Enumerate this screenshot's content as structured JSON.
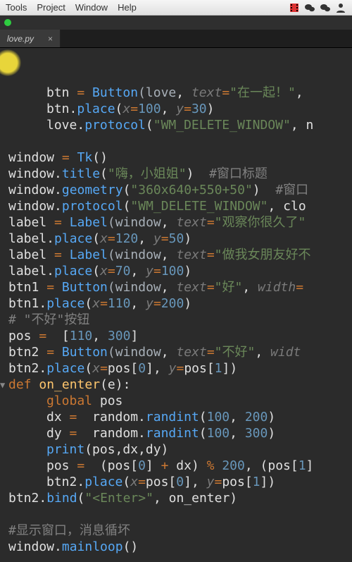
{
  "menubar": {
    "items": [
      "Tools",
      "Project",
      "Window",
      "Help"
    ],
    "right_icons": [
      "film-icon",
      "wechat-icon",
      "wechat-icon",
      "user-icon"
    ]
  },
  "tab": {
    "filename": "love.py",
    "close": "×"
  },
  "code": {
    "tokens": [
      [
        [
          "",
          ""
        ],
        [
          "btn ",
          "plain"
        ],
        [
          "= ",
          "op"
        ],
        [
          "Button",
          "call"
        ],
        [
          "(love",
          "arg"
        ],
        [
          ", ",
          "plain"
        ],
        [
          "text",
          "kwarg"
        ],
        [
          "=",
          "op"
        ],
        [
          "\"在一起！\"",
          "str"
        ],
        [
          ",",
          "plain"
        ]
      ],
      [
        [
          "",
          ""
        ],
        [
          "btn.",
          "plain"
        ],
        [
          "place",
          "call"
        ],
        [
          "(",
          "plain"
        ],
        [
          "x",
          "kwarg"
        ],
        [
          "=",
          "op"
        ],
        [
          "100",
          "num"
        ],
        [
          ", ",
          "plain"
        ],
        [
          "y",
          "kwarg"
        ],
        [
          "=",
          "op"
        ],
        [
          "30",
          "num"
        ],
        [
          ")",
          "plain"
        ]
      ],
      [
        [
          "",
          ""
        ],
        [
          "love.",
          "plain"
        ],
        [
          "protocol",
          "call"
        ],
        [
          "(",
          "plain"
        ],
        [
          "\"WM_DELETE_WINDOW\"",
          "str"
        ],
        [
          ", ",
          "plain"
        ],
        [
          "n",
          "plain"
        ]
      ],
      [
        [
          "",
          "blank"
        ]
      ],
      [
        [
          "window ",
          "plain"
        ],
        [
          "= ",
          "op"
        ],
        [
          "Tk",
          "call"
        ],
        [
          "()",
          "plain"
        ]
      ],
      [
        [
          "window.",
          "plain"
        ],
        [
          "title",
          "call"
        ],
        [
          "(",
          "plain"
        ],
        [
          "\"嗨，小姐姐\"",
          "str"
        ],
        [
          ")  ",
          "plain"
        ],
        [
          "#窗口标题",
          "comm"
        ]
      ],
      [
        [
          "window.",
          "plain"
        ],
        [
          "geometry",
          "call"
        ],
        [
          "(",
          "plain"
        ],
        [
          "\"360x640+550+50\"",
          "str"
        ],
        [
          ")  ",
          "plain"
        ],
        [
          "#窗口",
          "comm"
        ]
      ],
      [
        [
          "window.",
          "plain"
        ],
        [
          "protocol",
          "call"
        ],
        [
          "(",
          "plain"
        ],
        [
          "\"WM_DELETE_WINDOW\"",
          "str"
        ],
        [
          ", clo",
          "plain"
        ]
      ],
      [
        [
          "label ",
          "plain"
        ],
        [
          "= ",
          "op"
        ],
        [
          "Label",
          "call"
        ],
        [
          "(window",
          "arg"
        ],
        [
          ", ",
          "plain"
        ],
        [
          "text",
          "kwarg"
        ],
        [
          "=",
          "op"
        ],
        [
          "\"观察你很久了\"",
          "str"
        ]
      ],
      [
        [
          "label.",
          "plain"
        ],
        [
          "place",
          "call"
        ],
        [
          "(",
          "plain"
        ],
        [
          "x",
          "kwarg"
        ],
        [
          "=",
          "op"
        ],
        [
          "120",
          "num"
        ],
        [
          ", ",
          "plain"
        ],
        [
          "y",
          "kwarg"
        ],
        [
          "=",
          "op"
        ],
        [
          "50",
          "num"
        ],
        [
          ")",
          "plain"
        ]
      ],
      [
        [
          "label ",
          "plain"
        ],
        [
          "= ",
          "op"
        ],
        [
          "Label",
          "call"
        ],
        [
          "(window",
          "arg"
        ],
        [
          ", ",
          "plain"
        ],
        [
          "text",
          "kwarg"
        ],
        [
          "=",
          "op"
        ],
        [
          "\"做我女朋友好不",
          "str"
        ]
      ],
      [
        [
          "label.",
          "plain"
        ],
        [
          "place",
          "call"
        ],
        [
          "(",
          "plain"
        ],
        [
          "x",
          "kwarg"
        ],
        [
          "=",
          "op"
        ],
        [
          "70",
          "num"
        ],
        [
          ", ",
          "plain"
        ],
        [
          "y",
          "kwarg"
        ],
        [
          "=",
          "op"
        ],
        [
          "100",
          "num"
        ],
        [
          ")",
          "plain"
        ]
      ],
      [
        [
          "btn1 ",
          "plain"
        ],
        [
          "= ",
          "op"
        ],
        [
          "Button",
          "call"
        ],
        [
          "(window",
          "arg"
        ],
        [
          ", ",
          "plain"
        ],
        [
          "text",
          "kwarg"
        ],
        [
          "=",
          "op"
        ],
        [
          "\"好\"",
          "str"
        ],
        [
          ", ",
          "plain"
        ],
        [
          "width",
          "kwarg"
        ],
        [
          "=",
          "op"
        ]
      ],
      [
        [
          "btn1.",
          "plain"
        ],
        [
          "place",
          "call"
        ],
        [
          "(",
          "plain"
        ],
        [
          "x",
          "kwarg"
        ],
        [
          "=",
          "op"
        ],
        [
          "110",
          "num"
        ],
        [
          ", ",
          "plain"
        ],
        [
          "y",
          "kwarg"
        ],
        [
          "=",
          "op"
        ],
        [
          "200",
          "num"
        ],
        [
          ")",
          "plain"
        ]
      ],
      [
        [
          "# \"不好\"按钮",
          "comm"
        ]
      ],
      [
        [
          "pos ",
          "plain"
        ],
        [
          "= ",
          "op"
        ],
        [
          " [",
          "plain"
        ],
        [
          "110",
          "num"
        ],
        [
          ", ",
          "plain"
        ],
        [
          "300",
          "num"
        ],
        [
          "]",
          "plain"
        ]
      ],
      [
        [
          "btn2 ",
          "plain"
        ],
        [
          "= ",
          "op"
        ],
        [
          "Button",
          "call"
        ],
        [
          "(window",
          "arg"
        ],
        [
          ", ",
          "plain"
        ],
        [
          "text",
          "kwarg"
        ],
        [
          "=",
          "op"
        ],
        [
          "\"不好\"",
          "str"
        ],
        [
          ", ",
          "plain"
        ],
        [
          "widt",
          "kwarg"
        ]
      ],
      [
        [
          "btn2.",
          "plain"
        ],
        [
          "place",
          "call"
        ],
        [
          "(",
          "plain"
        ],
        [
          "x",
          "kwarg"
        ],
        [
          "=",
          "op"
        ],
        [
          "pos[",
          "plain"
        ],
        [
          "0",
          "num"
        ],
        [
          "], ",
          "plain"
        ],
        [
          "y",
          "kwarg"
        ],
        [
          "=",
          "op"
        ],
        [
          "pos[",
          "plain"
        ],
        [
          "1",
          "num"
        ],
        [
          "])",
          "plain"
        ]
      ],
      [
        [
          "def ",
          "def"
        ],
        [
          "on_enter",
          "fname"
        ],
        [
          "(e):",
          "plain"
        ]
      ],
      [
        [
          "",
          ""
        ],
        [
          "global ",
          "def"
        ],
        [
          "pos",
          "plain"
        ]
      ],
      [
        [
          "",
          ""
        ],
        [
          "dx ",
          "plain"
        ],
        [
          "= ",
          "op"
        ],
        [
          " random.",
          "plain"
        ],
        [
          "randint",
          "call"
        ],
        [
          "(",
          "plain"
        ],
        [
          "100",
          "num"
        ],
        [
          ", ",
          "plain"
        ],
        [
          "200",
          "num"
        ],
        [
          ")",
          "plain"
        ]
      ],
      [
        [
          "",
          ""
        ],
        [
          "dy ",
          "plain"
        ],
        [
          "= ",
          "op"
        ],
        [
          " random.",
          "plain"
        ],
        [
          "randint",
          "call"
        ],
        [
          "(",
          "plain"
        ],
        [
          "100",
          "num"
        ],
        [
          ", ",
          "plain"
        ],
        [
          "300",
          "num"
        ],
        [
          ")",
          "plain"
        ]
      ],
      [
        [
          "",
          ""
        ],
        [
          "print",
          "call"
        ],
        [
          "(pos,dx,dy)",
          "plain"
        ]
      ],
      [
        [
          "",
          ""
        ],
        [
          "pos ",
          "plain"
        ],
        [
          "= ",
          "op"
        ],
        [
          " (pos[",
          "plain"
        ],
        [
          "0",
          "num"
        ],
        [
          "] ",
          "plain"
        ],
        [
          "+",
          "op"
        ],
        [
          " dx) ",
          "plain"
        ],
        [
          "%",
          "op"
        ],
        [
          " ",
          "plain"
        ],
        [
          "200",
          "num"
        ],
        [
          ", (pos[",
          "plain"
        ],
        [
          "1",
          "num"
        ],
        [
          "]",
          "plain"
        ]
      ],
      [
        [
          "",
          ""
        ],
        [
          "btn2.",
          "plain"
        ],
        [
          "place",
          "call"
        ],
        [
          "(",
          "plain"
        ],
        [
          "x",
          "kwarg"
        ],
        [
          "=",
          "op"
        ],
        [
          "pos[",
          "plain"
        ],
        [
          "0",
          "num"
        ],
        [
          "], ",
          "plain"
        ],
        [
          "y",
          "kwarg"
        ],
        [
          "=",
          "op"
        ],
        [
          "pos[",
          "plain"
        ],
        [
          "1",
          "num"
        ],
        [
          "])",
          "plain"
        ]
      ],
      [
        [
          "btn2.",
          "plain"
        ],
        [
          "bind",
          "call"
        ],
        [
          "(",
          "plain"
        ],
        [
          "\"<Enter>\"",
          "str"
        ],
        [
          ", on_enter)",
          "plain"
        ]
      ],
      [
        [
          "",
          "blank"
        ]
      ],
      [
        [
          "#显示窗口，消息循坏",
          "comm"
        ]
      ],
      [
        [
          "window.",
          "plain"
        ],
        [
          "mainloop",
          "call"
        ],
        [
          "()",
          "plain"
        ]
      ]
    ],
    "indent1_lines": [
      0,
      1,
      2,
      19,
      20,
      21,
      22,
      23,
      24
    ],
    "fold_arrow_line": 18
  }
}
